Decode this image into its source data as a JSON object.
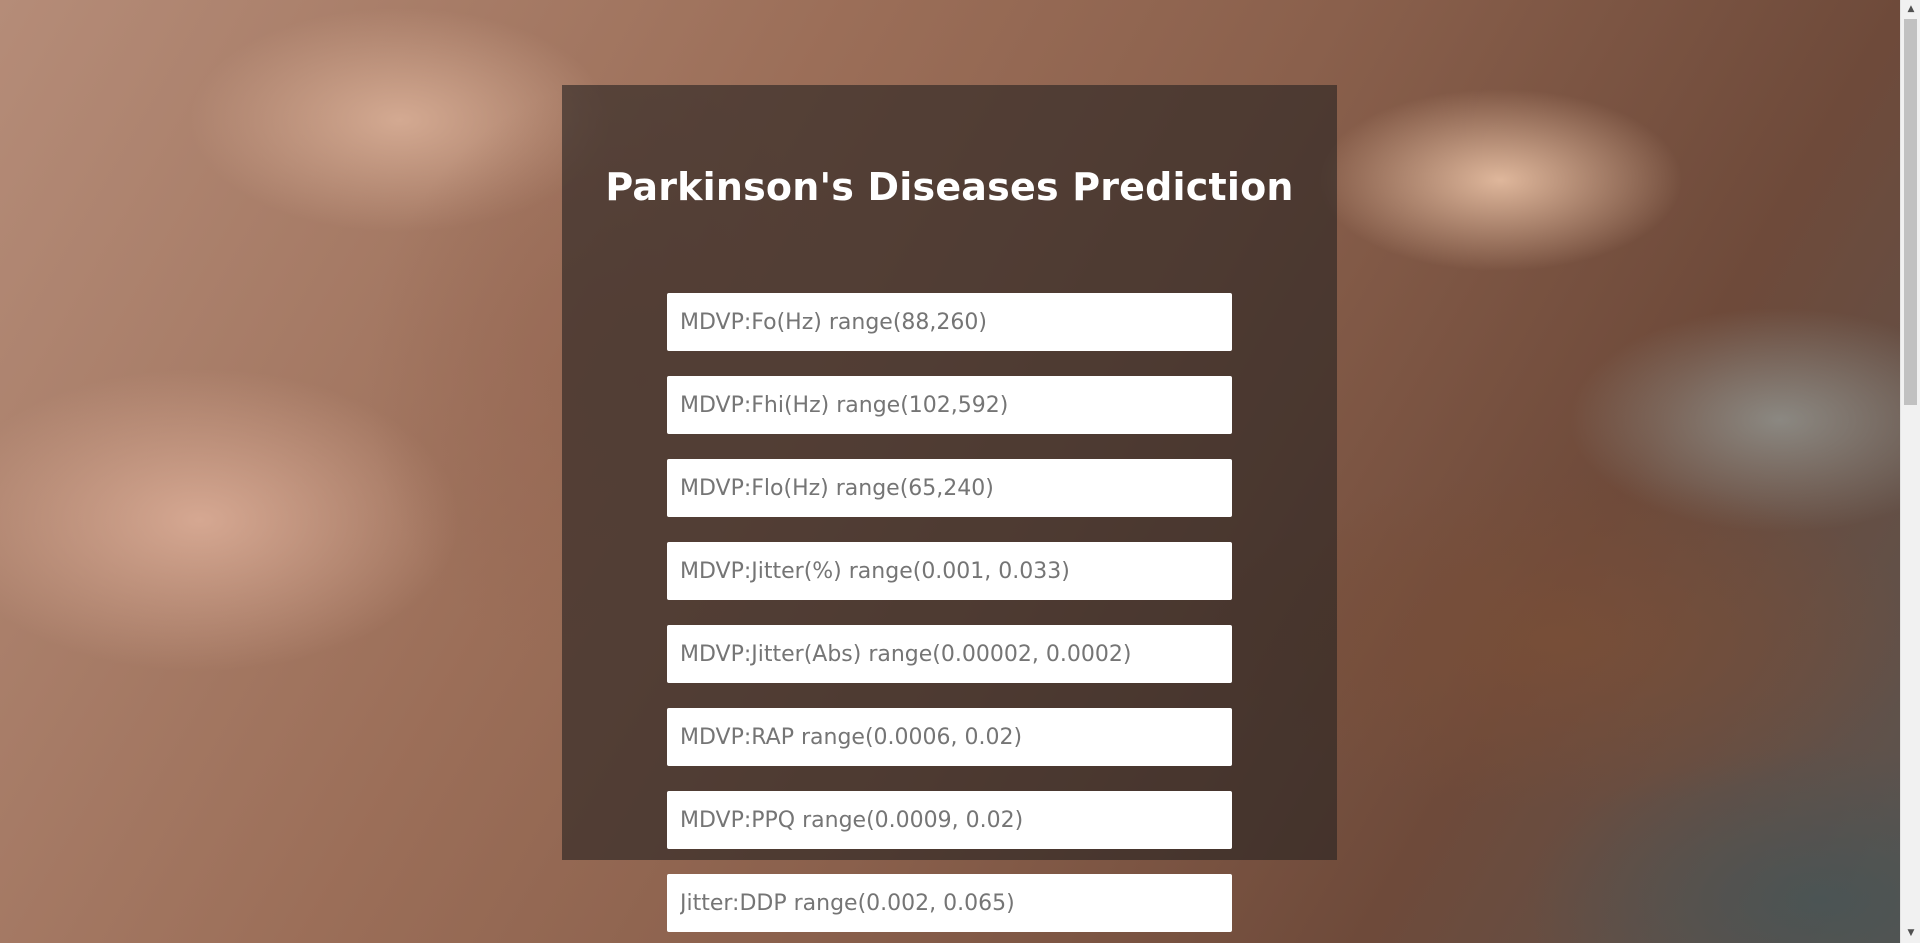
{
  "page": {
    "title": "Parkinson's Diseases Prediction"
  },
  "form": {
    "fields": [
      {
        "placeholder": "MDVP:Fo(Hz) range(88,260)",
        "value": ""
      },
      {
        "placeholder": "MDVP:Fhi(Hz) range(102,592)",
        "value": ""
      },
      {
        "placeholder": "MDVP:Flo(Hz) range(65,240)",
        "value": ""
      },
      {
        "placeholder": "MDVP:Jitter(%) range(0.001, 0.033)",
        "value": ""
      },
      {
        "placeholder": "MDVP:Jitter(Abs) range(0.00002, 0.0002)",
        "value": ""
      },
      {
        "placeholder": "MDVP:RAP range(0.0006, 0.02)",
        "value": ""
      },
      {
        "placeholder": "MDVP:PPQ range(0.0009, 0.02)",
        "value": ""
      },
      {
        "placeholder": "Jitter:DDP range(0.002, 0.065)",
        "value": ""
      }
    ]
  },
  "scrollbar": {
    "up_icon": "triangle-up-icon",
    "down_icon": "triangle-down-icon"
  },
  "colors": {
    "card_background": "#282422",
    "title_text": "#ffffff",
    "field_background": "#ffffff",
    "placeholder_text": "#757575"
  }
}
